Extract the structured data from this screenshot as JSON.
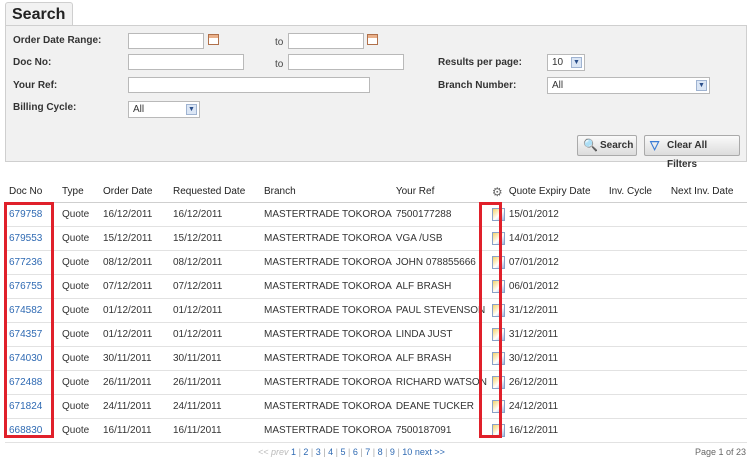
{
  "search": {
    "tab_title": "Search",
    "order_date_range_label": "Order Date Range:",
    "doc_no_label": "Doc No:",
    "your_ref_label": "Your Ref:",
    "billing_cycle_label": "Billing Cycle:",
    "to_label": "to",
    "results_per_page_label": "Results per page:",
    "results_per_page_value": "10",
    "branch_number_label": "Branch Number:",
    "branch_number_value": "All",
    "billing_cycle_value": "All",
    "search_button": "Search",
    "clear_button": "Clear All Filters"
  },
  "table": {
    "headers": [
      "Doc No",
      "Type",
      "Order Date",
      "Requested Date",
      "Branch",
      "Your Ref",
      "",
      "Quote Expiry Date",
      "Inv. Cycle",
      "Next Inv. Date"
    ],
    "rows": [
      {
        "doc": "679758",
        "type": "Quote",
        "order_date": "16/12/2011",
        "requested_date": "16/12/2011",
        "branch": "MASTERTRADE TOKOROA",
        "ref": "7500177288",
        "expiry": "15/01/2012"
      },
      {
        "doc": "679553",
        "type": "Quote",
        "order_date": "15/12/2011",
        "requested_date": "15/12/2011",
        "branch": "MASTERTRADE TOKOROA",
        "ref": "VGA /USB",
        "expiry": "14/01/2012"
      },
      {
        "doc": "677236",
        "type": "Quote",
        "order_date": "08/12/2011",
        "requested_date": "08/12/2011",
        "branch": "MASTERTRADE TOKOROA",
        "ref": "JOHN 078855666",
        "expiry": "07/01/2012"
      },
      {
        "doc": "676755",
        "type": "Quote",
        "order_date": "07/12/2011",
        "requested_date": "07/12/2011",
        "branch": "MASTERTRADE TOKOROA",
        "ref": "ALF BRASH",
        "expiry": "06/01/2012"
      },
      {
        "doc": "674582",
        "type": "Quote",
        "order_date": "01/12/2011",
        "requested_date": "01/12/2011",
        "branch": "MASTERTRADE TOKOROA",
        "ref": "PAUL STEVENSON",
        "expiry": "31/12/2011"
      },
      {
        "doc": "674357",
        "type": "Quote",
        "order_date": "01/12/2011",
        "requested_date": "01/12/2011",
        "branch": "MASTERTRADE TOKOROA",
        "ref": "LINDA JUST",
        "expiry": "31/12/2011"
      },
      {
        "doc": "674030",
        "type": "Quote",
        "order_date": "30/11/2011",
        "requested_date": "30/11/2011",
        "branch": "MASTERTRADE TOKOROA",
        "ref": "ALF BRASH",
        "expiry": "30/12/2011"
      },
      {
        "doc": "672488",
        "type": "Quote",
        "order_date": "26/11/2011",
        "requested_date": "26/11/2011",
        "branch": "MASTERTRADE TOKOROA",
        "ref": "RICHARD WATSON",
        "expiry": "26/12/2011"
      },
      {
        "doc": "671824",
        "type": "Quote",
        "order_date": "24/11/2011",
        "requested_date": "24/11/2011",
        "branch": "MASTERTRADE TOKOROA",
        "ref": "DEANE TUCKER",
        "expiry": "24/12/2011"
      },
      {
        "doc": "668830",
        "type": "Quote",
        "order_date": "16/11/2011",
        "requested_date": "16/11/2011",
        "branch": "MASTERTRADE TOKOROA",
        "ref": "7500187091",
        "expiry": "16/12/2011"
      }
    ]
  },
  "pager": {
    "prev": "<< prev",
    "pages": [
      "1",
      "2",
      "3",
      "4",
      "5",
      "6",
      "7",
      "8",
      "9",
      "10"
    ],
    "next": "next >>",
    "page_of": "Page 1 of 23"
  },
  "icons": {
    "calendar": "calendar-icon",
    "search": "magnifier-icon",
    "clear": "filter-clear-icon",
    "gear": "gear-icon",
    "quote": "quote-doc-icon"
  },
  "colors": {
    "link": "#2f6ab3",
    "highlight": "#e0202a",
    "panel": "#f1f1f1"
  }
}
